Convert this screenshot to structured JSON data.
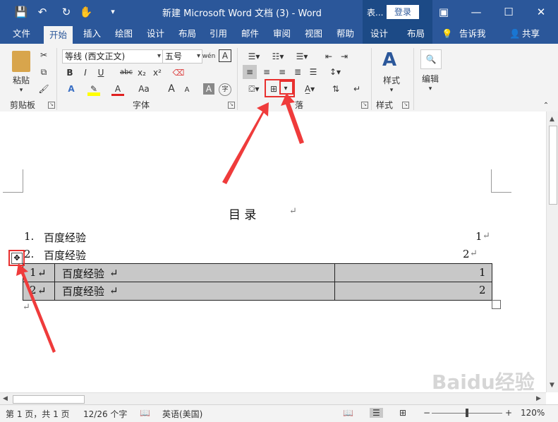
{
  "titlebar": {
    "title": "新建 Microsoft Word 文档 (3)  -  Word",
    "context_tab": "表...",
    "signin": "登录"
  },
  "tabs": [
    "文件",
    "开始",
    "插入",
    "绘图",
    "设计",
    "布局",
    "引用",
    "邮件",
    "审阅",
    "视图",
    "帮助",
    "设计",
    "布局"
  ],
  "tell_me": "告诉我",
  "share": "共享",
  "ribbon": {
    "clipboard": {
      "paste": "粘贴",
      "label": "剪贴板"
    },
    "font": {
      "name": "等线 (西文正文)",
      "size": "五号",
      "label": "字体",
      "bold": "B",
      "italic": "I",
      "underline": "U",
      "strike": "abc",
      "sub": "x₂",
      "sup": "x²",
      "aa": "Aa",
      "grow": "A",
      "shrink": "A",
      "wen": "wén",
      "charborder": "A"
    },
    "paragraph": {
      "label_visible": "落"
    },
    "styles": {
      "label": "样式",
      "button": "样式"
    },
    "editing": {
      "button": "编辑"
    }
  },
  "document": {
    "toc_title": "目        录",
    "toc_entries": [
      {
        "num": "1.",
        "text": "百度经验",
        "page": "1"
      },
      {
        "num": "2.",
        "text": "百度经验",
        "page": "2"
      }
    ],
    "table_rows": [
      {
        "num": "1",
        "text": "百度经验",
        "page": "1"
      },
      {
        "num": "2",
        "text": "百度经验",
        "page": "2"
      }
    ],
    "pilcrow": "↵"
  },
  "statusbar": {
    "page": "第 1 页，共 1 页",
    "words": "12/26 个字",
    "lang": "英语(美国)",
    "zoom": "120%"
  },
  "watermark": "Baidu经验",
  "colors": {
    "accent": "#2b579a",
    "highlight": "#e8302f",
    "table_shade": "#c8c8c8"
  }
}
